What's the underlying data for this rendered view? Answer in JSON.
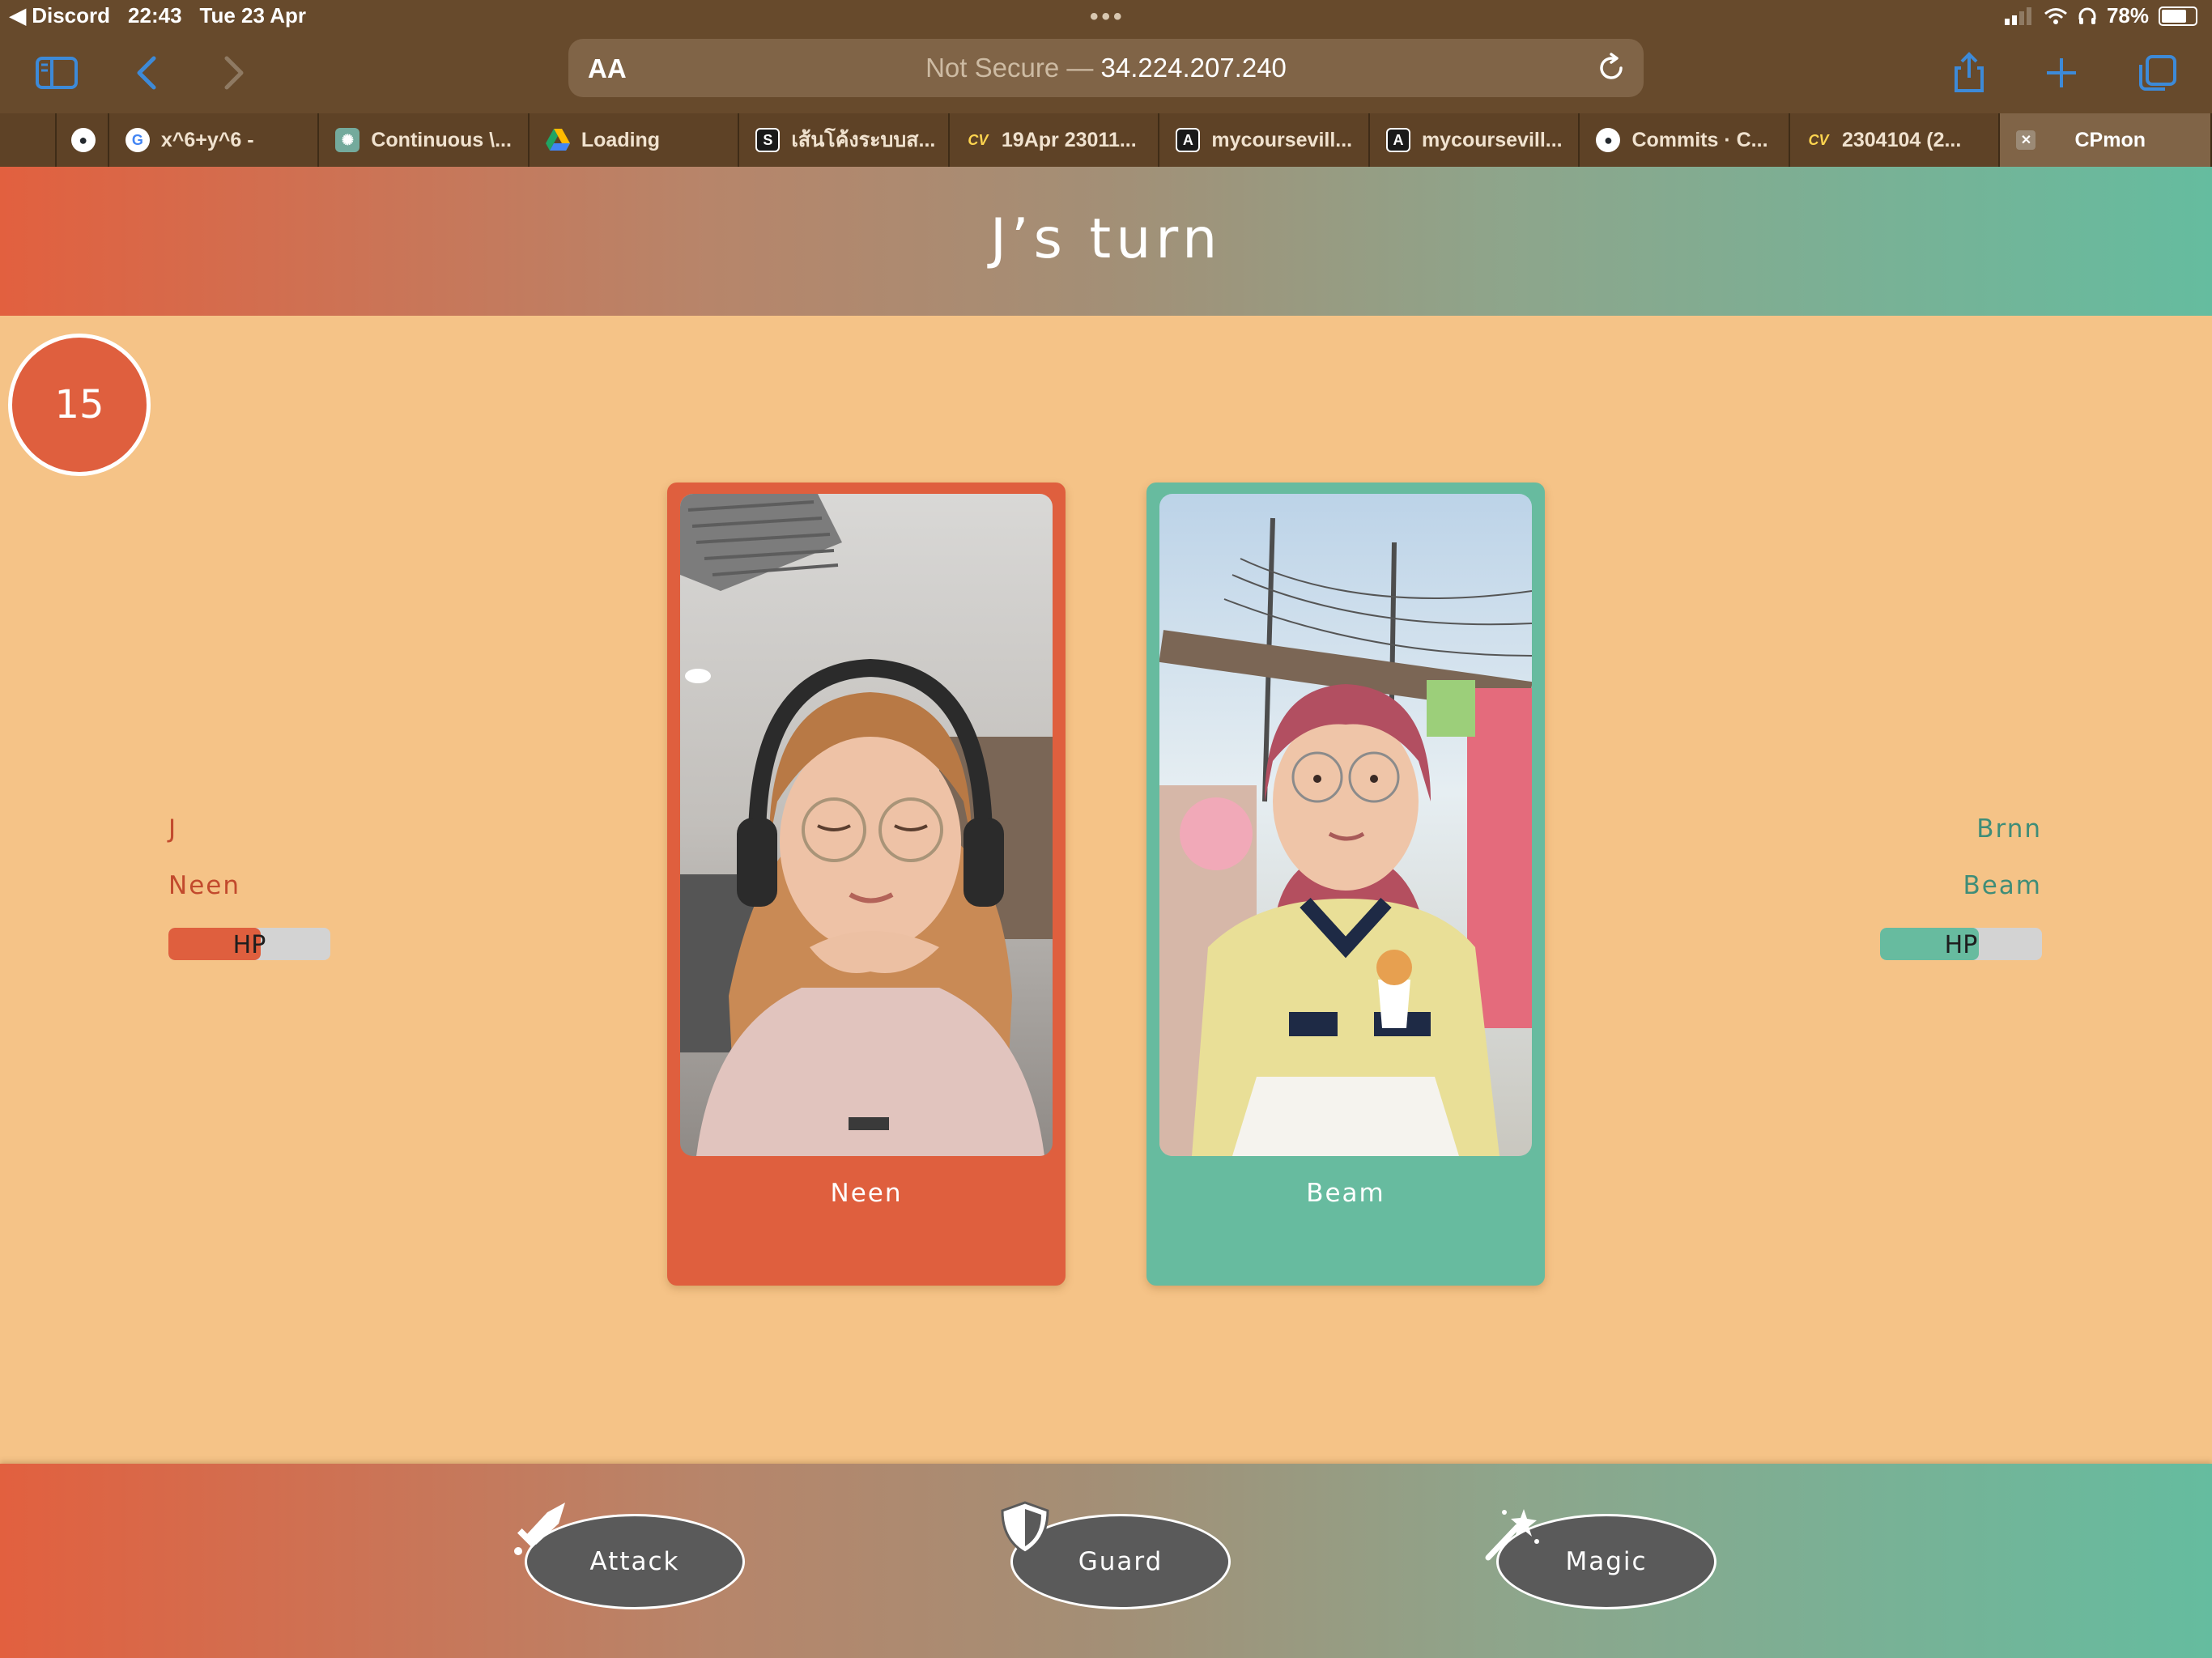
{
  "status_bar": {
    "back_app": "◀ Discord",
    "time": "22:43",
    "date": "Tue 23 Apr",
    "battery": "78%",
    "battery_level": 0.78
  },
  "browser": {
    "aa_label": "AA",
    "address_prefix": "Not Secure —",
    "address_host": "34.224.207.240",
    "tabs": [
      {
        "label": "",
        "icon": "partial-tab",
        "color": "#5e4226"
      },
      {
        "label": "",
        "icon": "github-icon",
        "color": "#24292e"
      },
      {
        "label": "x^6+y^6 -",
        "icon": "google-icon",
        "color": "#ffffff"
      },
      {
        "label": "Continuous \\...",
        "icon": "chatgpt-icon",
        "color": "#74aa9c"
      },
      {
        "label": "Loading",
        "icon": "google-drive-icon",
        "color": "#1fa463"
      },
      {
        "label": "เส้นโค้งระบบส...",
        "icon": "s-icon",
        "color": "#1a1a1a"
      },
      {
        "label": "19Apr 23011...",
        "icon": "cv-icon",
        "color": "#1565c0"
      },
      {
        "label": "mycoursevill...",
        "icon": "a-icon",
        "color": "#1a1a1a"
      },
      {
        "label": "mycoursevill...",
        "icon": "a-icon",
        "color": "#1a1a1a"
      },
      {
        "label": "Commits · C...",
        "icon": "github-icon",
        "color": "#24292e"
      },
      {
        "label": "2304104 (2...",
        "icon": "cv-icon",
        "color": "#1565c0"
      },
      {
        "label": "CPmon",
        "icon": "close-icon",
        "color": "#9b8a76"
      }
    ]
  },
  "game": {
    "turn_title": "J’s turn",
    "timer": "15",
    "left_player": {
      "player": "J",
      "monster": "Neen",
      "hp_label": "HP",
      "hp_fraction": 0.57,
      "color": "#df5f3e"
    },
    "right_player": {
      "player": "Brnn",
      "monster": "Beam",
      "hp_label": "HP",
      "hp_fraction": 0.61,
      "color": "#67bb9f"
    },
    "cards": [
      {
        "name": "Neen",
        "color": "#df5f3e"
      },
      {
        "name": "Beam",
        "color": "#67bb9f"
      }
    ],
    "actions": [
      {
        "label": "Attack",
        "icon": "sword-icon"
      },
      {
        "label": "Guard",
        "icon": "shield-icon"
      },
      {
        "label": "Magic",
        "icon": "magic-wand-icon"
      }
    ]
  }
}
